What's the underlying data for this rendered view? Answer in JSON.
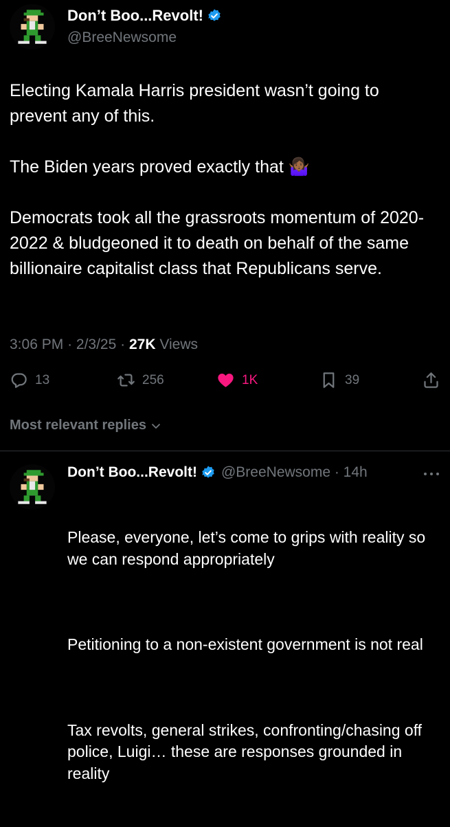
{
  "tweet": {
    "display_name": "Don’t Boo...Revolt!",
    "handle": "@BreeNewsome",
    "text": "Electing Kamala Harris president wasn’t going to prevent any of this.\n\nThe Biden years proved exactly that 🤷🏾‍♀️\n\nDemocrats took all the grassroots momentum of 2020-2022 & bludgeoned it to death on behalf of the same billionaire capitalist class that Republicans serve.",
    "time": "3:06 PM",
    "date": "2/3/25",
    "views_count": "27K",
    "views_label": "Views",
    "separator": "·"
  },
  "actions": {
    "replies": "13",
    "reposts": "256",
    "likes": "1K",
    "bookmarks": "39"
  },
  "replies_section": {
    "sort_label": "Most relevant replies"
  },
  "reply": {
    "display_name": "Don’t Boo...Revolt!",
    "handle_time": "@BreeNewsome · 14h",
    "paragraphs": [
      "Please, everyone, let’s come to grips with reality so we can respond appropriately",
      "Petitioning to a non-existent government is not real",
      "Tax revolts, general strikes, confronting/chasing off police, Luigi… these are responses grounded in reality"
    ]
  },
  "colors": {
    "background": "#000000",
    "text": "#e7e9ea",
    "muted": "#71767b",
    "verified": "#1d9bf0",
    "like": "#f91880",
    "divider": "#2f3336"
  },
  "icons": [
    "avatar-luigi-pixel",
    "verified-badge-icon",
    "reply-icon",
    "repost-icon",
    "heart-icon",
    "bookmark-icon",
    "share-icon",
    "chevron-down-icon",
    "more-icon"
  ]
}
